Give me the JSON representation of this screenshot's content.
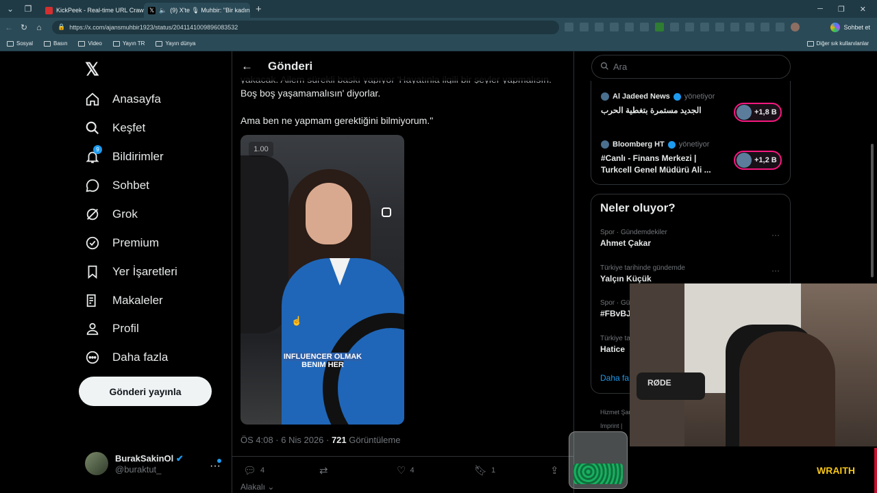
{
  "browser": {
    "tabs": [
      {
        "label": "KickPeek - Real-time URL Crawler",
        "active": false
      },
      {
        "label": "(9) X'te 🎙 Muhbir: \"Bir kadın",
        "active": true
      }
    ],
    "url": "https://x.com/ajansmuhbir1923/status/2041141009896083532",
    "copilot_label": "Sohbet et",
    "bookmarks": [
      "Sosyal",
      "Basın",
      "Video",
      "Yayın TR",
      "Yayın dünya"
    ],
    "bookmarks_right": "Diğer sık kullanılanlar"
  },
  "sidebar": {
    "items": [
      {
        "label": "Anasayfa",
        "icon": "home-icon"
      },
      {
        "label": "Keşfet",
        "icon": "search-icon"
      },
      {
        "label": "Bildirimler",
        "icon": "bell-icon",
        "badge": "9"
      },
      {
        "label": "Sohbet",
        "icon": "chat-icon"
      },
      {
        "label": "Grok",
        "icon": "grok-icon"
      },
      {
        "label": "Premium",
        "icon": "verified-icon"
      },
      {
        "label": "Yer İşaretleri",
        "icon": "bookmark-icon"
      },
      {
        "label": "Makaleler",
        "icon": "article-icon"
      },
      {
        "label": "Profil",
        "icon": "person-icon"
      },
      {
        "label": "Daha fazla",
        "icon": "more-icon"
      }
    ],
    "post_button": "Gönderi yayınla",
    "user": {
      "name": "BurakSakinOl",
      "handle": "@buraktut_"
    }
  },
  "post": {
    "header_title": "Gönderi",
    "text_line_cut": "yakacak. Ailem sürekli baskı yapıyor 'Hayatınla ilgili bir şeyler yapmalısın.",
    "text_line_2": "Boş boş yaşamamalısın' diyorlar.",
    "text_line_3": "Ama ben ne yapmam gerektiğini bilmiyorum.\"",
    "video": {
      "speed": "1.00",
      "caption_highlight": "INFLUENCER OLMAK",
      "caption_rest": "BENIM HER"
    },
    "meta_time": "ÖS 4:08 · 6 Nis 2026 · ",
    "meta_views": "721",
    "meta_views_label": " Görüntüleme",
    "actions": {
      "replies": "4",
      "likes": "4",
      "bookmarks": "1"
    },
    "related_label": "Alakalı"
  },
  "right": {
    "search_placeholder": "Ara",
    "live": [
      {
        "source": "Al Jadeed News",
        "role": "yönetiyor",
        "title": "الجديد مستمرة بتغطية الحرب",
        "count": "+1,8 B"
      },
      {
        "source": "Bloomberg HT",
        "role": "yönetiyor",
        "title": "#Canlı - Finans Merkezi | Turkcell Genel Müdürü Ali ...",
        "count": "+1,2 B"
      }
    ],
    "trends_title": "Neler oluyor?",
    "trends": [
      {
        "category": "Spor · Gündemdekiler",
        "name": "Ahmet Çakar"
      },
      {
        "category": "Türkiye tarihinde gündemde",
        "name": "Yalçın Küçük"
      },
      {
        "category": "Spor · Gü",
        "name": "#FBvBJ"
      },
      {
        "category": "Türkiye ta",
        "name": "Hatice"
      }
    ],
    "show_more": "Daha fa",
    "footer_1": "Hizmet Şar",
    "footer_2": "Imprint  |"
  },
  "overlay": {
    "mic_brand": "RØDE",
    "sponsor": "WRAITH"
  }
}
